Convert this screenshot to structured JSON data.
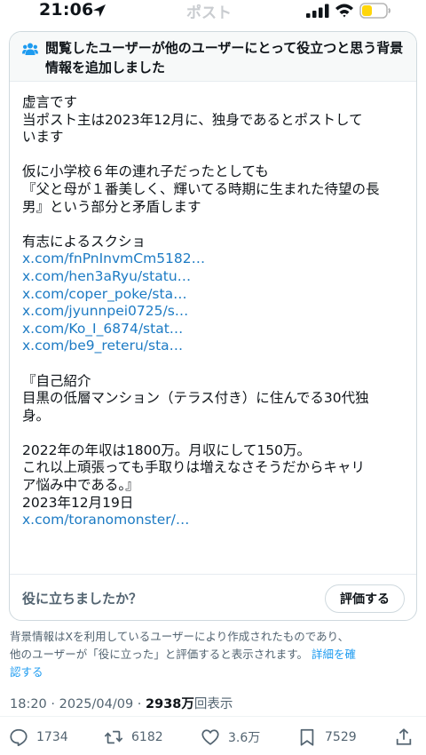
{
  "status_bar": {
    "time": "21:06",
    "ghost_title": "ポスト"
  },
  "note": {
    "header": "閲覧したユーザーが他のユーザーにとって役立つと思う背景情報を追加しました",
    "lines": [
      {
        "text": "虚言です",
        "type": "text"
      },
      {
        "text": "当ポスト主は2023年12月に、独身であるとポストして",
        "type": "text"
      },
      {
        "text": "います",
        "type": "text"
      },
      {
        "text": "",
        "type": "gap"
      },
      {
        "text": "仮に小学校６年の連れ子だったとしても",
        "type": "text"
      },
      {
        "text": "『父と母が１番美しく、輝いてる時期に生まれた待望の長",
        "type": "text"
      },
      {
        "text": "男』という部分と矛盾します",
        "type": "text"
      },
      {
        "text": "",
        "type": "gap"
      },
      {
        "text": "有志によるスクショ",
        "type": "text"
      },
      {
        "text": "x.com/fnPnInvmCm5182…",
        "type": "link"
      },
      {
        "text": "x.com/hen3aRyu/statu…",
        "type": "link"
      },
      {
        "text": "x.com/coper_poke/sta…",
        "type": "link"
      },
      {
        "text": "x.com/jyunnpei0725/s…",
        "type": "link"
      },
      {
        "text": "x.com/Ko_I_6874/stat…",
        "type": "link"
      },
      {
        "text": "x.com/be9_reteru/sta…",
        "type": "link"
      },
      {
        "text": "",
        "type": "gap"
      },
      {
        "text": "『自己紹介",
        "type": "text"
      },
      {
        "text": "目黒の低層マンション（テラス付き）に住んでる30代独",
        "type": "text"
      },
      {
        "text": "身。",
        "type": "text"
      },
      {
        "text": "",
        "type": "gap"
      },
      {
        "text": "2022年の年収は1800万。月収にして150万。",
        "type": "text"
      },
      {
        "text": "これ以上頑張っても手取りは増えなさそうだからキャリ",
        "type": "text"
      },
      {
        "text": "ア悩み中である。』",
        "type": "text"
      },
      {
        "text": "2023年12月19日",
        "type": "text"
      },
      {
        "text": "x.com/toranomonster/…",
        "type": "link"
      }
    ],
    "helpful_question": "役に立ちましたか？",
    "rate_button": "評価する"
  },
  "disclaimer": {
    "line1": "背景情報はXを利用しているユーザーにより作成されたものであり、",
    "line2_prefix": "他のユーザーが「役に立った」と評価すると表示されます。",
    "link_part1": "詳細を確",
    "link_part2": "認する"
  },
  "meta": {
    "time_date": "18:20 · 2025/04/09 · ",
    "views_count": "2938万",
    "views_label": "回表示"
  },
  "actions": {
    "replies": "1734",
    "reposts": "6182",
    "likes": "3.6万",
    "bookmarks": "7529"
  },
  "colors": {
    "text": "#0f1419",
    "secondary": "#536471",
    "link": "#1d9bf0",
    "border": "#cfd9de",
    "battery": "#ffd60a"
  },
  "icons": [
    "location-arrow-icon",
    "signal-icon",
    "wifi-icon",
    "battery-icon",
    "people-icon",
    "reply-icon",
    "repost-icon",
    "like-icon",
    "bookmark-icon",
    "share-icon"
  ]
}
